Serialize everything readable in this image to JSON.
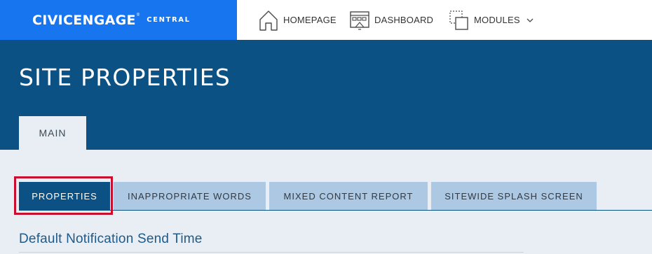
{
  "brand": {
    "name": "CIVICENGAGE",
    "trademark": "®",
    "sub": "CENTRAL",
    "color": "#1875f0"
  },
  "nav": {
    "items": [
      {
        "label": "HOMEPAGE",
        "icon": "home-icon"
      },
      {
        "label": "DASHBOARD",
        "icon": "dashboard-icon"
      },
      {
        "label": "MODULES",
        "icon": "modules-icon",
        "dropdown": true
      }
    ]
  },
  "header": {
    "title": "SITE PROPERTIES",
    "color": "#0b5184"
  },
  "tabs": [
    {
      "label": "MAIN",
      "active": true
    }
  ],
  "subtabs": [
    {
      "label": "PROPERTIES",
      "active": true
    },
    {
      "label": "INAPPROPRIATE WORDS",
      "active": false
    },
    {
      "label": "MIXED CONTENT REPORT",
      "active": false
    },
    {
      "label": "SITEWIDE SPLASH SCREEN",
      "active": false
    }
  ],
  "highlight_color": "#c8102e",
  "section": {
    "title": "Default Notification Send Time"
  }
}
